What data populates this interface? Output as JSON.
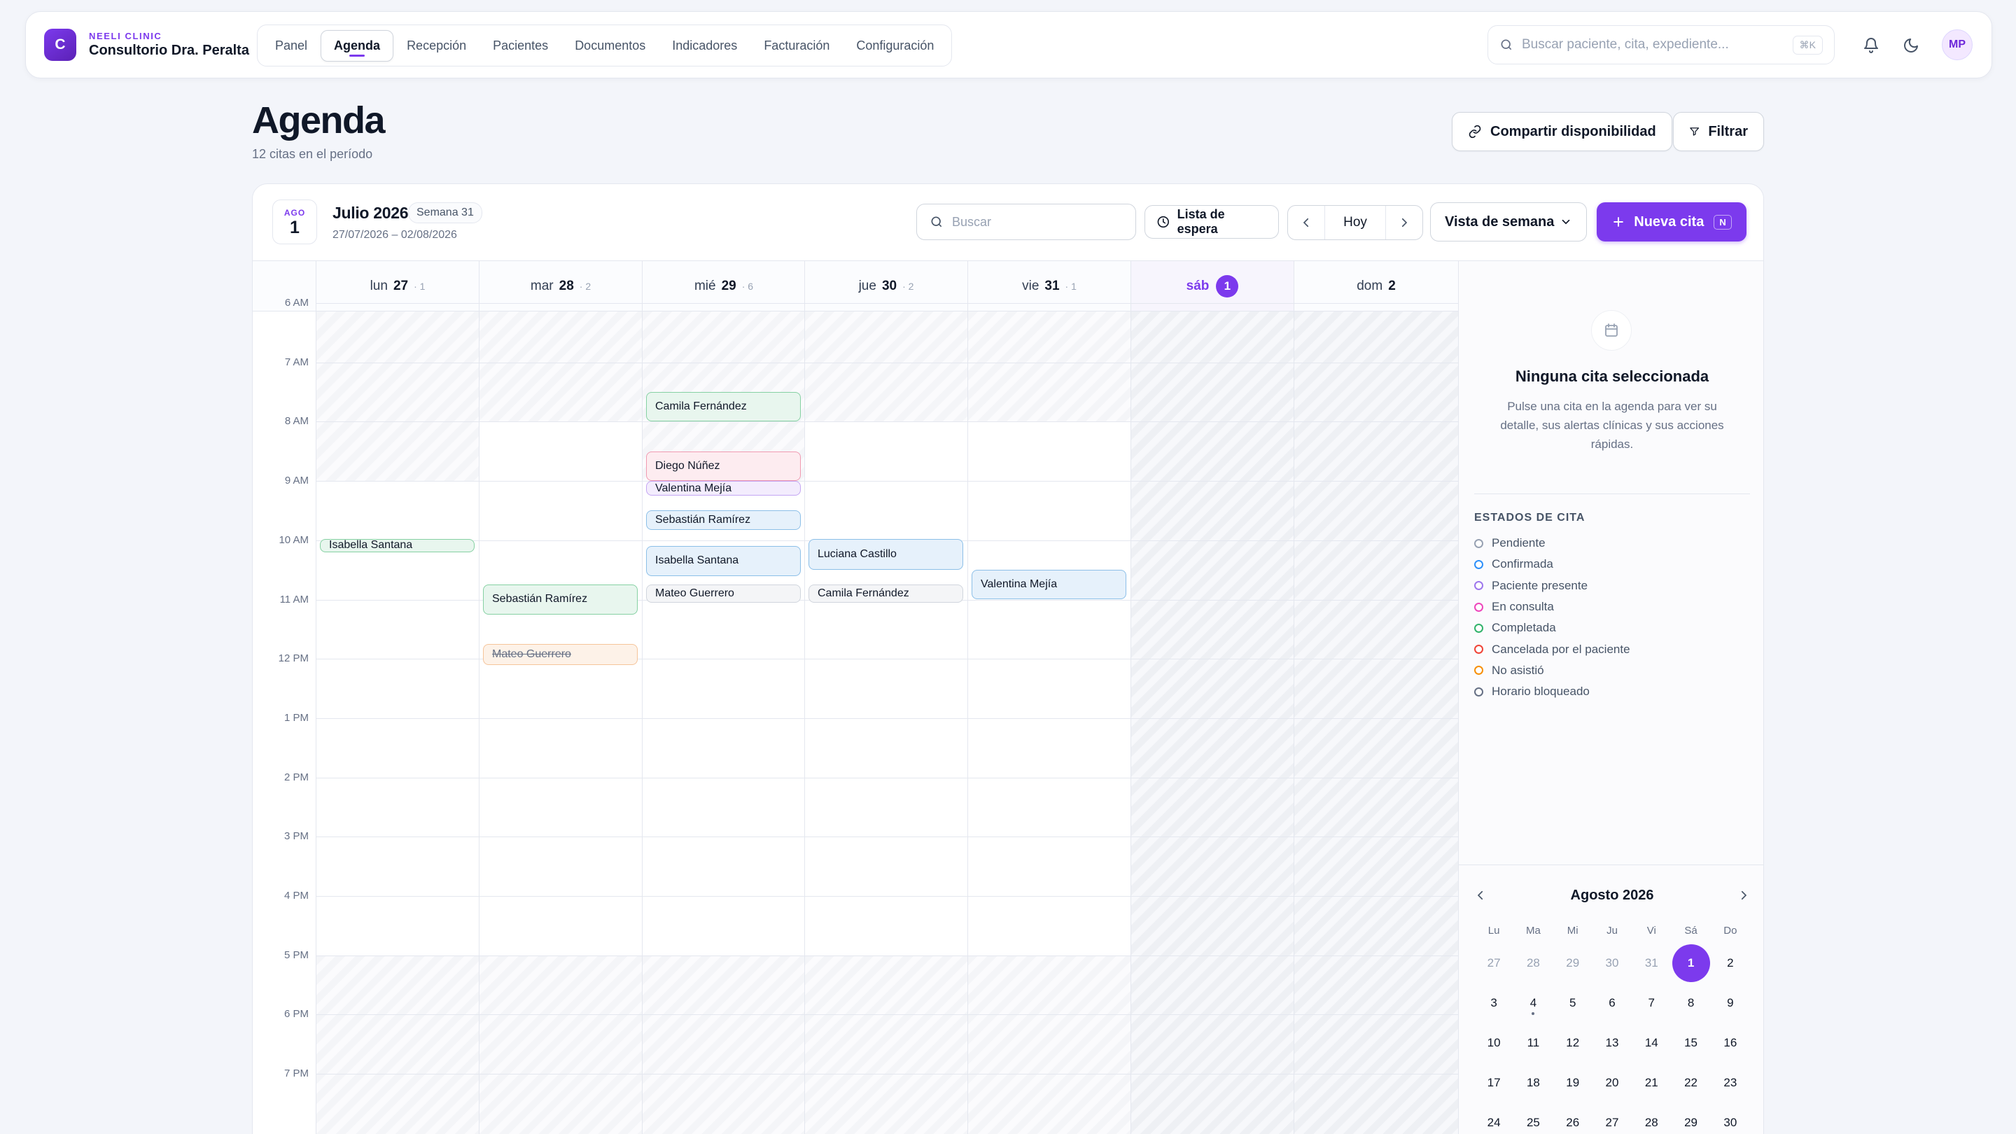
{
  "brand": {
    "sub": "NEELI CLINIC",
    "name": "Consultorio Dra. Peralta",
    "logo_letter": "C"
  },
  "nav": {
    "tabs": [
      "Panel",
      "Agenda",
      "Recepción",
      "Pacientes",
      "Documentos",
      "Indicadores",
      "Facturación",
      "Configuración"
    ],
    "active": "Agenda"
  },
  "topsearch": {
    "placeholder": "Buscar paciente, cita, expediente...",
    "shortcut": "⌘K"
  },
  "user": {
    "initials": "MP"
  },
  "page": {
    "title": "Agenda",
    "subtitle": "12 citas en el período"
  },
  "actions": {
    "share": "Compartir disponibilidad",
    "filter": "Filtrar"
  },
  "toolbar": {
    "date_month": "AGO",
    "date_day": "1",
    "period": "Julio 2026",
    "week": "Semana 31",
    "range": "27/07/2026 – 02/08/2026",
    "search_placeholder": "Buscar",
    "waitlist": "Lista de espera",
    "today": "Hoy",
    "view": "Vista de semana",
    "new": "Nueva cita",
    "new_key": "N"
  },
  "days": [
    {
      "dow": "lun",
      "num": "27",
      "count": "· 1"
    },
    {
      "dow": "mar",
      "num": "28",
      "count": "· 2"
    },
    {
      "dow": "mié",
      "num": "29",
      "count": "· 6"
    },
    {
      "dow": "jue",
      "num": "30",
      "count": "· 2"
    },
    {
      "dow": "vie",
      "num": "31",
      "count": "· 1"
    },
    {
      "dow": "sáb",
      "num": "1",
      "count": ""
    },
    {
      "dow": "dom",
      "num": "2",
      "count": ""
    }
  ],
  "hours": [
    "6 AM",
    "7 AM",
    "8 AM",
    "9 AM",
    "10 AM",
    "11 AM",
    "12 PM",
    "1 PM",
    "2 PM",
    "3 PM",
    "4 PM",
    "5 PM",
    "6 PM",
    "7 PM"
  ],
  "events": [
    {
      "name": "Camila Fernández",
      "day": 2,
      "start": 7.5,
      "end": 8.0,
      "status": "done"
    },
    {
      "name": "Diego Núñez",
      "day": 2,
      "start": 8.5,
      "end": 9.0,
      "status": "cons"
    },
    {
      "name": "Valentina Mejía",
      "day": 2,
      "start": 9.0,
      "end": 9.25,
      "status": "pres"
    },
    {
      "name": "Sebastián Ramírez",
      "day": 2,
      "start": 9.5,
      "end": 9.83,
      "status": "conf"
    },
    {
      "name": "Isabella Santana",
      "day": 2,
      "start": 10.1,
      "end": 10.6,
      "status": "conf"
    },
    {
      "name": "Mateo Guerrero",
      "day": 2,
      "start": 10.75,
      "end": 11.05,
      "status": "pend"
    },
    {
      "name": "Isabella Santana",
      "day": 0,
      "start": 9.98,
      "end": 10.2,
      "status": "done"
    },
    {
      "name": "Sebastián Ramírez",
      "day": 1,
      "start": 10.75,
      "end": 11.25,
      "status": "done"
    },
    {
      "name": "Mateo Guerrero",
      "day": 1,
      "start": 11.75,
      "end": 12.1,
      "status": "noshow"
    },
    {
      "name": "Luciana Castillo",
      "day": 3,
      "start": 9.98,
      "end": 10.5,
      "status": "conf"
    },
    {
      "name": "Camila Fernández",
      "day": 3,
      "start": 10.75,
      "end": 11.05,
      "status": "pend"
    },
    {
      "name": "Valentina Mejía",
      "day": 4,
      "start": 10.5,
      "end": 11.0,
      "status": "conf"
    }
  ],
  "side": {
    "empty_title": "Ninguna cita seleccionada",
    "empty_desc": "Pulse una cita en la agenda para ver su detalle, sus alertas clínicas y sus acciones rápidas.",
    "legend_title": "ESTADOS DE CITA",
    "legend": [
      {
        "label": "Pendiente",
        "color": "#98a2b3"
      },
      {
        "label": "Confirmada",
        "color": "#2e90fa"
      },
      {
        "label": "Paciente presente",
        "color": "#9e77ed"
      },
      {
        "label": "En consulta",
        "color": "#ee46bc"
      },
      {
        "label": "Completada",
        "color": "#32b36b"
      },
      {
        "label": "Cancelada por el paciente",
        "color": "#f04438"
      },
      {
        "label": "No asistió",
        "color": "#f79009"
      },
      {
        "label": "Horario bloqueado",
        "color": "#667085"
      }
    ]
  },
  "mini": {
    "title": "Agosto 2026",
    "dow": [
      "Lu",
      "Ma",
      "Mi",
      "Ju",
      "Vi",
      "Sá",
      "Do"
    ],
    "days": [
      "27",
      "28",
      "29",
      "30",
      "31",
      "1",
      "2",
      "3",
      "4",
      "5",
      "6",
      "7",
      "8",
      "9",
      "10",
      "11",
      "12",
      "13",
      "14",
      "15",
      "16",
      "17",
      "18",
      "19",
      "20",
      "21",
      "22",
      "23",
      "24",
      "25",
      "26",
      "27",
      "28",
      "29",
      "30"
    ],
    "other_month_count": 5,
    "selected_index": 5,
    "marked_index": 8
  },
  "colors": {
    "accent": "#7c3aed"
  }
}
